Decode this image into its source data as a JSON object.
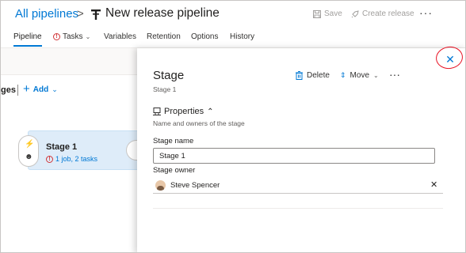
{
  "header": {
    "breadcrumb": "All pipelines",
    "separator": ">",
    "title": "New release pipeline",
    "save_label": "Save",
    "create_release_label": "Create release",
    "more": "···",
    "pipeline_icon": "pipeline-icon",
    "save_icon": "save-icon",
    "rocket_icon": "rocket-icon"
  },
  "tabs": [
    {
      "label": "Pipeline",
      "active": true
    },
    {
      "label": "Tasks",
      "has_error": true,
      "has_dropdown": true
    },
    {
      "label": "Variables"
    },
    {
      "label": "Retention"
    },
    {
      "label": "Options"
    },
    {
      "label": "History"
    }
  ],
  "canvas": {
    "stages_label": "ges",
    "add_label": "Add",
    "stage_card": {
      "name": "Stage 1",
      "summary": "1 job, 2 tasks",
      "status_icon": "error-icon"
    }
  },
  "panel": {
    "title": "Stage",
    "subtitle": "Stage 1",
    "delete_label": "Delete",
    "move_label": "Move",
    "more": "···",
    "close_icon": "close-icon",
    "close_highlight_color": "#e81123",
    "properties": {
      "header": "Properties",
      "description": "Name and owners of the stage"
    },
    "stage_name_label": "Stage name",
    "stage_name_value": "Stage 1",
    "stage_owner_label": "Stage owner",
    "stage_owner_value": "Steve Spencer"
  },
  "colors": {
    "accent": "#0078d4",
    "error": "#d13438",
    "stage_card_bg": "#deecf9"
  }
}
